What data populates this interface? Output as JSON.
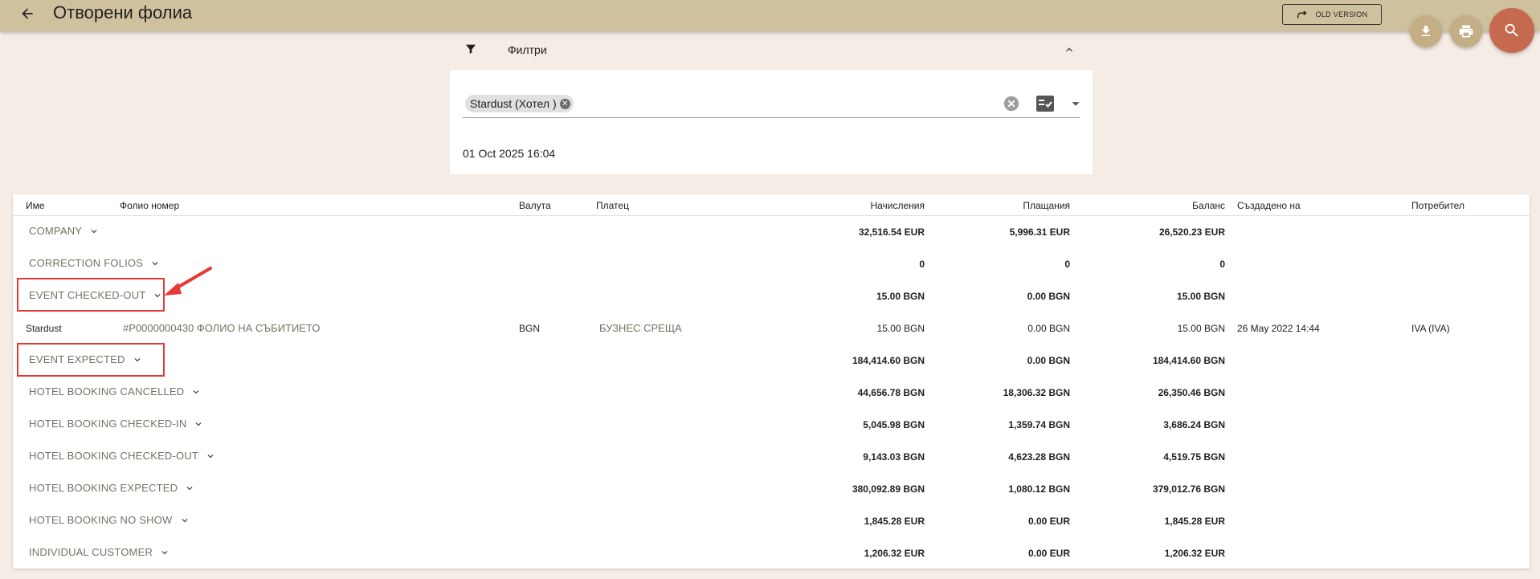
{
  "header": {
    "title": "Отворени фолиа",
    "old_version_label": "OLD VERSION",
    "icons": [
      "arrow-back-icon",
      "redo-icon",
      "download-icon",
      "print-icon",
      "search-icon"
    ]
  },
  "filters": {
    "label": "Филтри",
    "chip": "Stardust (Хотел )",
    "date": "01 Oct 2025 16:04"
  },
  "table": {
    "columns": {
      "name": "Име",
      "folio": "Фолио номер",
      "currency": "Валута",
      "payer": "Платец",
      "charges": "Начисления",
      "payments": "Плащания",
      "balance": "Баланс",
      "created": "Създадено на",
      "user": "Потребител"
    },
    "groups": [
      {
        "label": "COMPANY",
        "charges": "32,516.54 EUR",
        "payments": "5,996.31 EUR",
        "balance": "26,520.23 EUR"
      },
      {
        "label": "CORRECTION FOLIOS",
        "charges": "0",
        "payments": "0",
        "balance": "0"
      },
      {
        "label": "EVENT CHECKED-OUT",
        "charges": "15.00 BGN",
        "payments": "0.00 BGN",
        "balance": "15.00 BGN"
      },
      {
        "label": "EVENT EXPECTED",
        "charges": "184,414.60 BGN",
        "payments": "0.00 BGN",
        "balance": "184,414.60 BGN"
      },
      {
        "label": "HOTEL BOOKING CANCELLED",
        "charges": "44,656.78 BGN",
        "payments": "18,306.32 BGN",
        "balance": "26,350.46 BGN"
      },
      {
        "label": "HOTEL BOOKING CHECKED-IN",
        "charges": "5,045.98 BGN",
        "payments": "1,359.74 BGN",
        "balance": "3,686.24 BGN"
      },
      {
        "label": "HOTEL BOOKING CHECKED-OUT",
        "charges": "9,143.03 BGN",
        "payments": "4,623.28 BGN",
        "balance": "4,519.75 BGN"
      },
      {
        "label": "HOTEL BOOKING EXPECTED",
        "charges": "380,092.89 BGN",
        "payments": "1,080.12 BGN",
        "balance": "379,012.76 BGN"
      },
      {
        "label": "HOTEL BOOKING NO SHOW",
        "charges": "1,845.28 EUR",
        "payments": "0.00 EUR",
        "balance": "1,845.28 EUR"
      },
      {
        "label": "INDIVIDUAL CUSTOMER",
        "charges": "1,206.32 EUR",
        "payments": "0.00 EUR",
        "balance": "1,206.32 EUR"
      }
    ],
    "detail_row": {
      "name": "Stardust",
      "folio": "#P0000000430 ФОЛИО НА СЪБИТИЕТО",
      "currency": "BGN",
      "payer": "БУЗНЕС СРЕЩА",
      "charges": "15.00 BGN",
      "payments": "0.00 BGN",
      "balance": "15.00 BGN",
      "created": "26 May 2022 14:44",
      "user": "IVA (IVA)"
    }
  },
  "colors": {
    "header_bg": "#d0c19e",
    "page_bg": "#f5ede5",
    "fab_small": "#c4ae85",
    "fab_search": "#c66a4f",
    "group_text": "#6f7560",
    "annotation": "#e53935"
  }
}
